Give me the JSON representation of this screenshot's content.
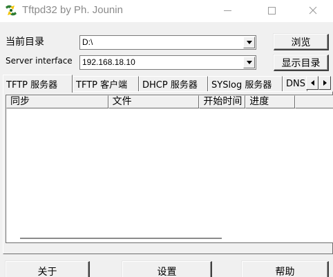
{
  "window": {
    "title": "Tftpd32 by Ph. Jounin",
    "icon": "tftpd-app-icon",
    "controls": {
      "minimize": "minimize-icon",
      "maximize": "maximize-icon",
      "close": "close-icon"
    }
  },
  "form": {
    "current_dir_label": "当前目录",
    "current_dir_value": "D:\\",
    "browse_button": "浏览",
    "server_interface_label": "Server interface",
    "server_interface_value": "192.168.18.10",
    "show_dir_button": "显示目录"
  },
  "tabs": [
    {
      "label": "TFTP 服务器",
      "active": true
    },
    {
      "label": "TFTP 客户端",
      "active": false
    },
    {
      "label": "DHCP 服务器",
      "active": false
    },
    {
      "label": "SYSlog 服务器",
      "active": false
    },
    {
      "label": "DNS",
      "active": false
    }
  ],
  "table": {
    "columns": [
      "同步",
      "文件",
      "开始时间",
      "进度",
      ""
    ]
  },
  "footer": {
    "about_button": "关于",
    "settings_button": "设置",
    "help_button": "帮助"
  },
  "colors": {
    "window_bg": "#f0f0f0",
    "title_text": "#8a8a8a",
    "list_bg": "#ffffff"
  }
}
